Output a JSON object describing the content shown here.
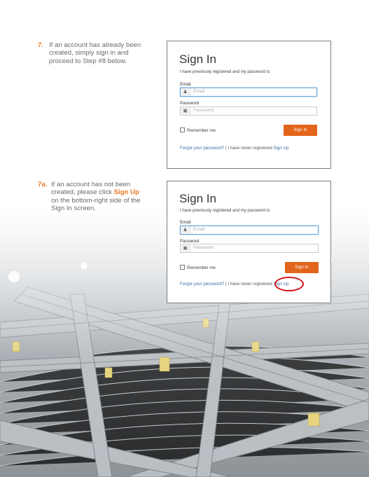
{
  "steps": [
    {
      "num": "7.",
      "lines": [
        "If an account has already been",
        "created, simply sign in and",
        "proceed to Step #8 below."
      ]
    },
    {
      "num": "7a.",
      "line1": "If an account has not been",
      "line2_pre": "created, please click ",
      "line2_hl": "Sign Up",
      "line3": "on the bottom-right side of the",
      "line4": "Sign In screen."
    }
  ],
  "signin": {
    "title": "Sign In",
    "subtitle": "I have previously registered and my password is:",
    "email_label": "Email",
    "email_placeholder": "Email",
    "password_label": "Password",
    "password_placeholder": "Password",
    "remember_label": "Remember me",
    "button_label": "Sign In",
    "forgot_link": "Forgot your password?",
    "separator": "|",
    "never_registered": "I have never registered",
    "signup_link": "Sign Up"
  },
  "icons": {
    "user": "user-icon",
    "lock": "lock-icon"
  },
  "colors": {
    "accent": "#e87722",
    "button": "#e2651b",
    "link": "#3a6ea5",
    "highlight_circle": "#d0141a"
  }
}
